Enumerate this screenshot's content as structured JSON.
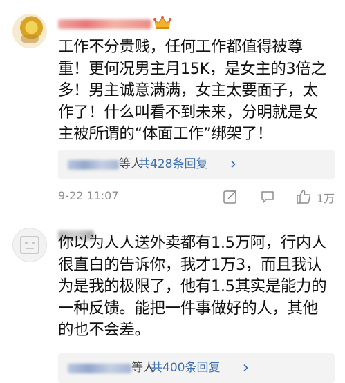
{
  "comments": [
    {
      "text": "工作不分贵贱，任何工作都值得被尊\n重！更何况男主月15K，是女主的3倍之\n多！男主诚意满满，女主太要面子，太\n作了！什么叫看不到未来，分明就是女\n主被所谓的“体面工作”绑架了！",
      "reply_tail": "等人",
      "reply_total": "共428条回复",
      "timestamp": "9-22 11:07",
      "like_count": "1万"
    },
    {
      "text": "你以为人人送外卖都有1.5万阿，行内人\n很直白的告诉你，我才1万3，而且我认\n为是我的极限了，他有1.5其实是能力的\n一种反馈。能把一件事做好的人，其他\n的也不会差。",
      "reply_tail": "等人",
      "reply_total": "共400条回复"
    }
  ],
  "icons": {
    "badge": "crown-icon",
    "share": "share-icon",
    "comment": "comment-icon",
    "like": "thumbs-up-icon",
    "more": "chevron-right-icon",
    "default_avatar": "default-avatar-icon"
  },
  "colors": {
    "link": "#3f6fb0",
    "meta": "#8c8c8c",
    "reply_bg": "#f3f3f3",
    "text": "#111111"
  }
}
